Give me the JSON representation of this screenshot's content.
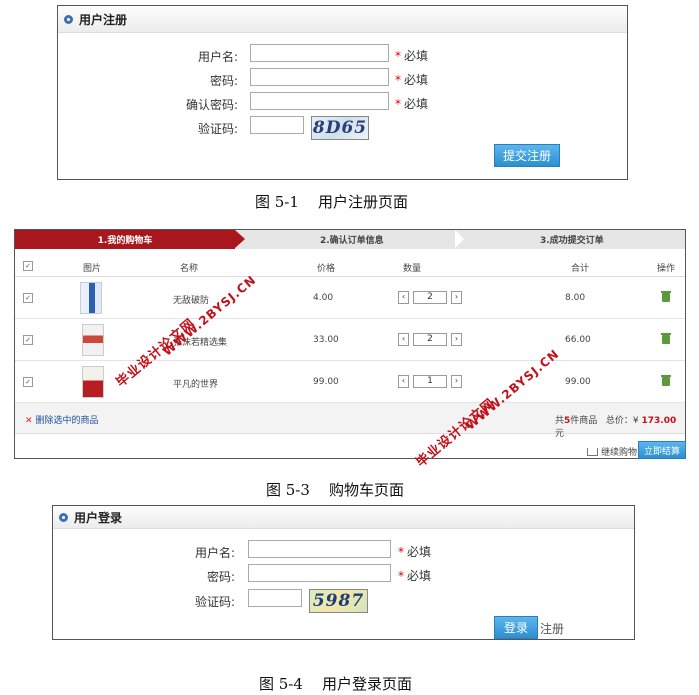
{
  "register": {
    "title": "用户注册",
    "username_label": "用户名:",
    "password_label": "密码:",
    "confirm_label": "确认密码:",
    "captcha_label": "验证码:",
    "required": "必填",
    "captcha_text": "8D65",
    "submit": "提交注册"
  },
  "cart": {
    "steps": [
      "1.我的购物车",
      "2.确认订单信息",
      "3.成功提交订单"
    ],
    "headers": {
      "image": "图片",
      "name": "名称",
      "price": "价格",
      "qty": "数量",
      "total": "合计",
      "action": "操作"
    },
    "items": [
      {
        "name": "无敌破防",
        "price": "4.00",
        "qty": "2",
        "total": "8.00"
      },
      {
        "name": "张沫若精选集",
        "price": "33.00",
        "qty": "2",
        "total": "66.00"
      },
      {
        "name": "平凡的世界",
        "price": "99.00",
        "qty": "1",
        "total": "99.00"
      }
    ],
    "delete_selected": "删除选中的商品",
    "count_prefix": "共",
    "count": "5",
    "count_suffix": "件商品",
    "total_label": "总价：",
    "total_currency": "¥",
    "total_value": "173.00",
    "total_unit": "元",
    "continue": "继续购物",
    "checkout": "立即结算",
    "watermark_cn": "毕业设计论文网",
    "watermark_url": "WWW.2BYSJ.CN"
  },
  "login": {
    "title": "用户登录",
    "username_label": "用户名:",
    "password_label": "密码:",
    "captcha_label": "验证码:",
    "required": "必填",
    "captcha_text": "5987",
    "submit": "登录",
    "register_link": "注册"
  },
  "captions": {
    "fig1": "图 5-1    用户注册页面",
    "fig3": "图 5-3    购物车页面",
    "fig4": "图 5-4    用户登录页面"
  }
}
